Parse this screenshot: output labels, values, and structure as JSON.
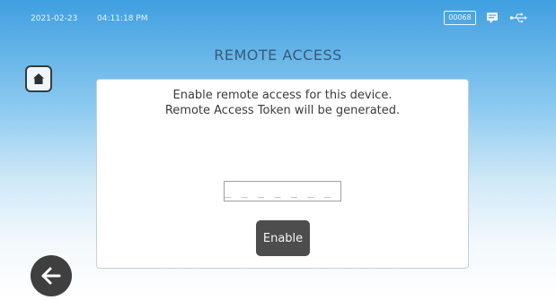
{
  "status_bar": {
    "date": "2021-02-23",
    "time": "04:11:18 PM",
    "count": "00068",
    "icons": [
      "message-icon",
      "usb-icon"
    ]
  },
  "page": {
    "title": "REMOTE ACCESS"
  },
  "dialog": {
    "line1": "Enable remote access for this device.",
    "line2": "Remote Access Token will be generated.",
    "token_placeholder": "_ _ _ _ _ _ _ _",
    "enable_label": "Enable"
  },
  "nav": {
    "home_icon": "home-icon",
    "back_icon": "back-arrow-icon"
  },
  "colors": {
    "sky_top": "#3f9fe0",
    "title_text": "#3a5a78",
    "button_dark": "#4d4d4d",
    "back_button": "#3f3f3f"
  }
}
